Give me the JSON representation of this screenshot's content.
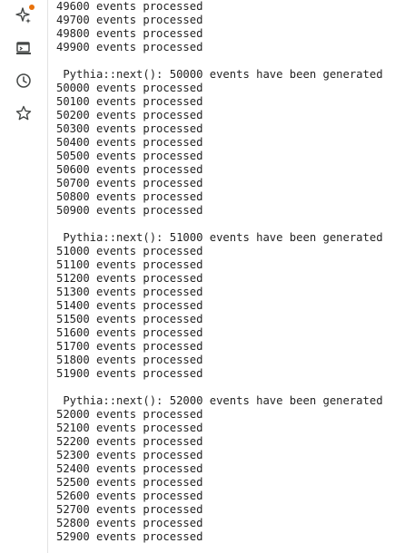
{
  "rail": {
    "items": [
      {
        "icon": "sparkle-icon",
        "badge": true,
        "badge_color": "#e8710a"
      },
      {
        "icon": "terminal-icon"
      },
      {
        "icon": "history-icon"
      },
      {
        "icon": "star-icon"
      }
    ]
  },
  "output": {
    "lines": [
      "49600 events processed",
      "49700 events processed",
      "49800 events processed",
      "49900 events processed",
      "",
      " Pythia::next(): 50000 events have been generated",
      "50000 events processed",
      "50100 events processed",
      "50200 events processed",
      "50300 events processed",
      "50400 events processed",
      "50500 events processed",
      "50600 events processed",
      "50700 events processed",
      "50800 events processed",
      "50900 events processed",
      "",
      " Pythia::next(): 51000 events have been generated",
      "51000 events processed",
      "51100 events processed",
      "51200 events processed",
      "51300 events processed",
      "51400 events processed",
      "51500 events processed",
      "51600 events processed",
      "51700 events processed",
      "51800 events processed",
      "51900 events processed",
      "",
      " Pythia::next(): 52000 events have been generated",
      "52000 events processed",
      "52100 events processed",
      "52200 events processed",
      "52300 events processed",
      "52400 events processed",
      "52500 events processed",
      "52600 events processed",
      "52700 events processed",
      "52800 events processed",
      "52900 events processed"
    ]
  }
}
